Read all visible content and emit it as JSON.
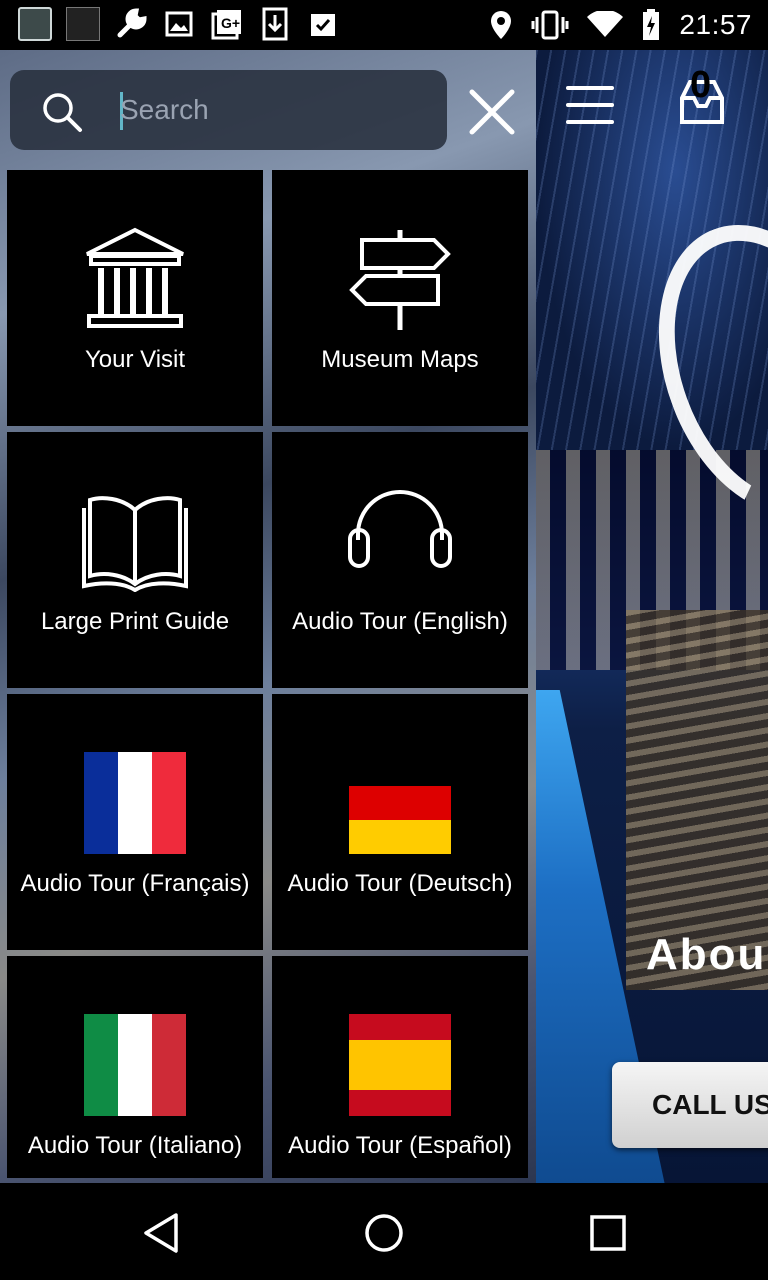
{
  "status_bar": {
    "time": "21:57",
    "notification_icons": [
      "launcher-app-icon",
      "sky-app-icon",
      "wrench-icon",
      "image-icon",
      "google-plus-icon",
      "download-icon",
      "clipboard-check-icon"
    ],
    "system_icons": [
      "location-icon",
      "vibrate-icon",
      "wifi-icon",
      "battery-charging-icon"
    ]
  },
  "search": {
    "placeholder": "Search",
    "value": ""
  },
  "menu": {
    "tiles": [
      {
        "label": "Your Visit",
        "icon": "museum-building-icon"
      },
      {
        "label": "Museum Maps",
        "icon": "signpost-icon"
      },
      {
        "label": "Large Print Guide",
        "icon": "open-book-icon"
      },
      {
        "label": "Audio Tour (English)",
        "icon": "headphones-icon"
      },
      {
        "label": "Audio Tour (Français)",
        "icon": "french-flag-icon",
        "colors": [
          "#0a2e9a",
          "#ffffff",
          "#ef2b3c"
        ]
      },
      {
        "label": "Audio Tour (Deutsch)",
        "icon": "german-flag-icon",
        "colors": [
          "#dd0000",
          "#ffcc00"
        ]
      },
      {
        "label": "Audio Tour (Italiano)",
        "icon": "italian-flag-icon",
        "colors": [
          "#0f8c45",
          "#ffffff",
          "#ce2b37"
        ]
      },
      {
        "label": "Audio Tour (Español)",
        "icon": "spanish-flag-icon",
        "colors": [
          "#c60b1e",
          "#ffc400"
        ]
      }
    ]
  },
  "background": {
    "about_text": "Abou",
    "call_button": "CALL US",
    "cart_count": "0"
  },
  "navigation_bar": {
    "buttons": [
      "back-icon",
      "home-icon",
      "recents-icon"
    ]
  }
}
